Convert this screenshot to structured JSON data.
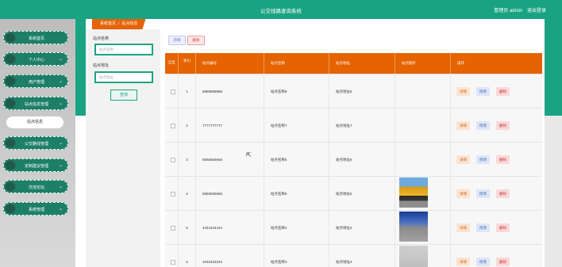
{
  "app": {
    "title": "公交线路查询系统",
    "user_label": "管理员 admin",
    "logout": "退出登录"
  },
  "sidebar": {
    "items": [
      {
        "label": "系统首页",
        "chevron": ""
      },
      {
        "label": "个人中心",
        "chevron": "⌄"
      },
      {
        "label": "用户管理",
        "chevron": "⌄"
      },
      {
        "label": "站点信息管理",
        "chevron": "⌄"
      },
      {
        "label": "公交路线管理",
        "chevron": "⌄"
      },
      {
        "label": "定制建议管理",
        "chevron": "⌄"
      },
      {
        "label": "交流论坛",
        "chevron": "⌄"
      },
      {
        "label": "系统管理",
        "chevron": "⌄"
      }
    ],
    "active_sub": "站点信息"
  },
  "breadcrumb": {
    "home": "系统首页",
    "sep": "/",
    "current": "站点信息"
  },
  "search": {
    "station_name_label": "站点名称",
    "station_name_placeholder": "站点名称",
    "station_addr_label": "站点地址",
    "station_addr_placeholder": "站点地址",
    "query_button": "查询"
  },
  "toolbar": {
    "add": "新增",
    "delete": "删除"
  },
  "table": {
    "headers": {
      "select": "全选",
      "index": "索引",
      "number": "站点编号",
      "name": "站点名称",
      "address": "站点地址",
      "image": "站点图片",
      "actions": "操作"
    },
    "action_labels": {
      "detail": "详情",
      "edit": "修改",
      "delete": "删除"
    },
    "rows": [
      {
        "index": "1",
        "number": "8888888888",
        "name": "站点名称8",
        "address": "站点地址8",
        "image": "none"
      },
      {
        "index": "2",
        "number": "7777777777",
        "name": "站点名称7",
        "address": "站点地址7",
        "image": "none"
      },
      {
        "index": "3",
        "number": "6666666666",
        "name": "站点名称6",
        "address": "站点地址6",
        "image": "none"
      },
      {
        "index": "4",
        "number": "5555555555",
        "name": "站点名称5",
        "address": "站点地址5",
        "image": "bus-yellow"
      },
      {
        "index": "5",
        "number": "4444444444",
        "name": "站点名称4",
        "address": "站点地址4",
        "image": "bus-blue"
      },
      {
        "index": "6",
        "number": "3333333333",
        "name": "站点名称3",
        "address": "站点地址3",
        "image": "bus-grey"
      }
    ]
  },
  "colors": {
    "primary_green": "#1aa383",
    "accent_orange": "#e56300"
  }
}
